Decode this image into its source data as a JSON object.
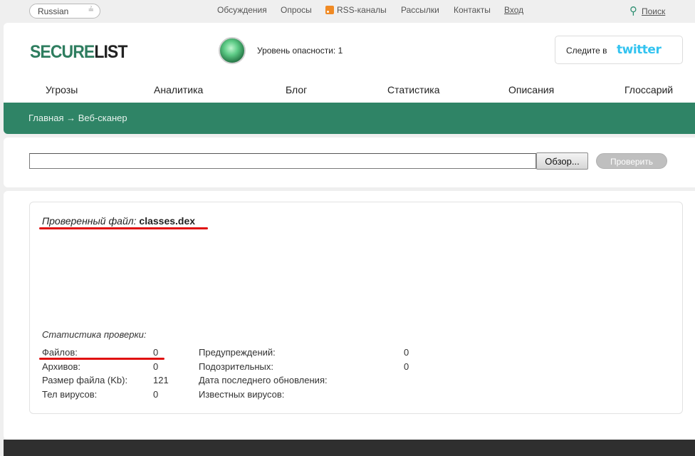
{
  "topbar": {
    "language": "Russian",
    "links": [
      "Обсуждения",
      "Опросы",
      "RSS-каналы",
      "Рассылки",
      "Контакты",
      "Вход"
    ],
    "search_label": "Поиск"
  },
  "header": {
    "logo_secure": "SECURE",
    "logo_list": "LIST",
    "threat_level": "Уровень опасности: 1",
    "follow_label": "Следите в",
    "twitter_label": "twitter"
  },
  "nav": [
    "Угрозы",
    "Аналитика",
    "Блог",
    "Статистика",
    "Описания",
    "Глоссарий"
  ],
  "breadcrumb": {
    "home": "Главная",
    "arrow": "→",
    "current": "Веб-сканер"
  },
  "scanner": {
    "file_value": "",
    "browse_label": "Обзор...",
    "check_label": "Проверить"
  },
  "results": {
    "checked_prefix": "Проверенный файл:",
    "checked_file": "classes.dex",
    "stats_title": "Статистика проверки:",
    "left": [
      {
        "label": "Файлов:",
        "value": "0"
      },
      {
        "label": "Архивов:",
        "value": "0"
      },
      {
        "label": "Размер файла (Kb):",
        "value": "121"
      },
      {
        "label": "Тел вирусов:",
        "value": "0"
      }
    ],
    "right": [
      {
        "label": "Предупреждений:",
        "value": "0"
      },
      {
        "label": "Подозрительных:",
        "value": "0"
      },
      {
        "label": "Дата последнего обновления:",
        "value": ""
      },
      {
        "label": "Известных вирусов:",
        "value": ""
      }
    ]
  },
  "colors": {
    "brand_green": "#2f8466",
    "highlight_red": "#e01010"
  }
}
